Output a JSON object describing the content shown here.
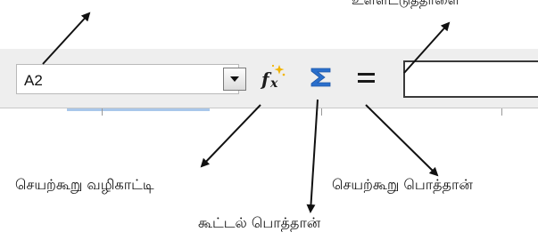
{
  "name_box": {
    "value": "A2"
  },
  "toolbar": {
    "function_wizard_icon": "fx-function-wizard-icon",
    "sum_icon": "sigma-sum-icon",
    "function_icon": "equals-function-icon",
    "function_glyph": "=",
    "sum_glyph": "Σ",
    "input_line_value": ""
  },
  "captions": {
    "input_line": "உள்ளீட்டுத்தாளை",
    "function_wizard": "செயற்கூறு வழிகாட்டி",
    "sum": "கூட்டல் பொத்தான்",
    "function": "செயற்கூறு பொத்தான்"
  },
  "colors": {
    "toolbar_background": "#eeeeee",
    "sum_icon": "#2a6fcc",
    "fx_icon": "#1a1a1a",
    "fx_sparkle": "#f2b400"
  }
}
